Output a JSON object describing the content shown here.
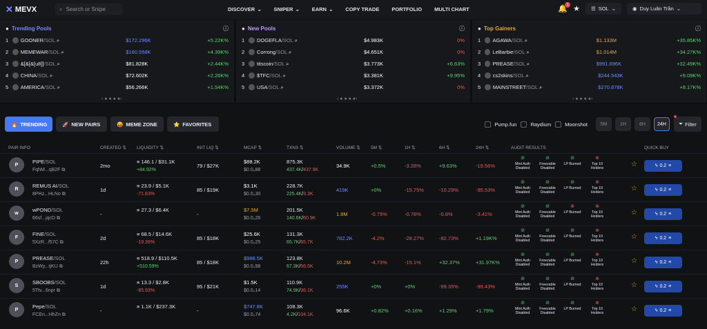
{
  "nav": {
    "logo": "MEVX",
    "search_placeholder": "Search or Snipe",
    "menu": [
      {
        "label": "DISCOVER",
        "has_caret": true
      },
      {
        "label": "SNIPER",
        "has_caret": true
      },
      {
        "label": "EARN",
        "has_caret": true
      },
      {
        "label": "COPY TRADE",
        "has_caret": false
      },
      {
        "label": "PORTFOLIO",
        "has_caret": false
      },
      {
        "label": "MULTI CHART",
        "has_caret": false
      }
    ],
    "notification_count": "1",
    "chain": "SOL",
    "user": "Duy Luân Trần"
  },
  "panels": [
    {
      "title": "Trending Pools",
      "title_color": "#6f8cff",
      "rows": [
        {
          "n": "1",
          "name": "GOONER",
          "pair": "/SOL",
          "value": "$172.296K",
          "value_color": "#6f8cff",
          "change": "+5.22K%",
          "change_color": "#5bd172"
        },
        {
          "n": "2",
          "name": "MEMEWAR",
          "pair": "/SOL",
          "value": "$160.558K",
          "value_color": "#6f8cff",
          "change": "+4.39K%",
          "change_color": "#5bd172"
        },
        {
          "n": "3",
          "name": "&[&[&[u8]]",
          "pair": "/SOL",
          "value": "$81.828K",
          "value_color": "#ffffff",
          "change": "+2.44K%",
          "change_color": "#5bd172"
        },
        {
          "n": "4",
          "name": "CHINA",
          "pair": "/SOL",
          "value": "$72.602K",
          "value_color": "#ffffff",
          "change": "+2.26K%",
          "change_color": "#5bd172"
        },
        {
          "n": "5",
          "name": "AMERICA",
          "pair": "/SOL",
          "value": "$56.266K",
          "value_color": "#ffffff",
          "change": "+1.54K%",
          "change_color": "#5bd172"
        }
      ]
    },
    {
      "title": "New Pools",
      "title_color": "#b999ff",
      "rows": [
        {
          "n": "1",
          "name": "DOGEFLA",
          "pair": "/SOL",
          "value": "$4.983K",
          "value_color": "#ffffff",
          "change": "0%",
          "change_color": "#e05b5b"
        },
        {
          "n": "2",
          "name": "Corrong",
          "pair": "/SOL",
          "value": "$4.651K",
          "value_color": "#ffffff",
          "change": "0%",
          "change_color": "#e05b5b"
        },
        {
          "n": "3",
          "name": "titscoin",
          "pair": "/SOL",
          "value": "$3.773K",
          "value_color": "#ffffff",
          "change": "+6.63%",
          "change_color": "#5bd172"
        },
        {
          "n": "4",
          "name": "$TFC",
          "pair": "/SOL",
          "value": "$3.381K",
          "value_color": "#ffffff",
          "change": "+9.95%",
          "change_color": "#5bd172"
        },
        {
          "n": "5",
          "name": "USA",
          "pair": "/SOL",
          "value": "$3.372K",
          "value_color": "#ffffff",
          "change": "0%",
          "change_color": "#e05b5b"
        }
      ]
    },
    {
      "title": "Top Gainers",
      "title_color": "#e2a93e",
      "rows": [
        {
          "n": "1",
          "name": "AGAWA",
          "pair": "/SOL",
          "value": "$1.133M",
          "value_color": "#e2a93e",
          "change": "+35.85K%",
          "change_color": "#5bd172"
        },
        {
          "n": "2",
          "name": "LeBarbie",
          "pair": "/SOL",
          "value": "$1.014M",
          "value_color": "#e2a93e",
          "change": "+34.27K%",
          "change_color": "#5bd172"
        },
        {
          "n": "3",
          "name": "PREASE",
          "pair": "/SOL",
          "value": "$991.696K",
          "value_color": "#6f8cff",
          "change": "+32.49K%",
          "change_color": "#5bd172"
        },
        {
          "n": "4",
          "name": "cs2skins",
          "pair": "/SOL",
          "value": "$244.543K",
          "value_color": "#6f8cff",
          "change": "+9.09K%",
          "change_color": "#5bd172"
        },
        {
          "n": "5",
          "name": "MAINSTREET",
          "pair": "/SOL",
          "value": "$270.878K",
          "value_color": "#6f8cff",
          "change": "+8.17K%",
          "change_color": "#5bd172"
        }
      ]
    }
  ],
  "tabs": [
    {
      "label": "TRENDING",
      "icon": "🔥",
      "active": true
    },
    {
      "label": "NEW PAIRS",
      "icon": "🚀",
      "active": false
    },
    {
      "label": "MEME ZONE",
      "icon": "😝",
      "active": false
    },
    {
      "label": "FAVORITES",
      "icon": "⭐",
      "active": false
    }
  ],
  "filters": {
    "sources": [
      "Pump.fun",
      "Raydium",
      "Moonshot"
    ],
    "timeframes": [
      "5M",
      "1H",
      "6H",
      "24H"
    ],
    "active_timeframe": "24H",
    "filter_label": "Filter"
  },
  "headers": [
    "PAIR INFO",
    "CREATED",
    "LIQUIDITY",
    "INIT LIQ",
    "MCAP",
    "TXNS",
    "VOLUME",
    "5M",
    "1H",
    "6H",
    "24H",
    "AUDIT RESULTS",
    "QUICK BUY"
  ],
  "audit_labels": [
    "Mint Auth Disabled",
    "Freezable Disabled",
    "LP Burned",
    "Top 10 Holders"
  ],
  "rows": [
    {
      "name": "PIPE",
      "pair": "/SOL",
      "addr": "FqhM...qB2F",
      "created": "2mo",
      "liq": "146.1 / $31.1K",
      "liq_chg": "+84.92%",
      "liq_chg_color": "#5bd172",
      "init": "79 / $27K",
      "mcap": "$88.2K",
      "mcap_color": "#ffffff",
      "mcap_sub": "$0.0₀88",
      "txns": "875.3K",
      "buys": "437.4K",
      "sells": "437.9K",
      "vol": "34.9K",
      "vol_color": "#ffffff",
      "m5": "+0.5%",
      "m5_color": "#5bd172",
      "h1": "-3.28%",
      "h1_color": "#e05b5b",
      "h6": "+9.63%",
      "h6_color": "#5bd172",
      "h24": "-19.56%",
      "h24_color": "#e05b5b",
      "audit": [
        "ok",
        "ok",
        "ok",
        "bad"
      ],
      "buy": "0.2"
    },
    {
      "name": "REMUS AI",
      "pair": "/SOL",
      "addr": "8PHz...HLNo",
      "created": "1d",
      "liq": "23.9 / $5.1K",
      "liq_chg": "-71.83%",
      "liq_chg_color": "#e05b5b",
      "init": "85 / $19K",
      "mcap": "$3.1K",
      "mcap_color": "#ffffff",
      "mcap_sub": "$0.0₀30",
      "txns": "228.7K",
      "buys": "225.4K",
      "sells": "3.3K",
      "vol": "419K",
      "vol_color": "#6f8cff",
      "m5": "+0%",
      "m5_color": "#5bd172",
      "h1": "-15.75%",
      "h1_color": "#e05b5b",
      "h6": "-10.29%",
      "h6_color": "#e05b5b",
      "h24": "-95.53%",
      "h24_color": "#e05b5b",
      "audit": [
        "ok",
        "ok",
        "ok",
        "bad"
      ],
      "buy": "0.2"
    },
    {
      "name": "wPOND",
      "pair": "/SOL",
      "addr": "66sf...jqcD",
      "created": "-",
      "liq": "27.3 / $6.4K",
      "liq_chg": "",
      "liq_chg_color": "#5bd172",
      "init": "-",
      "mcap": "$7.5M",
      "mcap_color": "#e2a93e",
      "mcap_sub": "$0.0₀26",
      "txns": "201.5K",
      "buys": "140.6K",
      "sells": "60.9K",
      "vol": "1.8M",
      "vol_color": "#e2a93e",
      "m5": "-0.79%",
      "m5_color": "#e05b5b",
      "h1": "-0.78%",
      "h1_color": "#e05b5b",
      "h6": "-0.8%",
      "h6_color": "#e05b5b",
      "h24": "-3.41%",
      "h24_color": "#e05b5b",
      "audit": [
        "ok",
        "ok",
        "bad",
        "bad"
      ],
      "buy": "0.2"
    },
    {
      "name": "FINE",
      "pair": "/SOL",
      "addr": "5XzR...f57C",
      "created": "2d",
      "liq": "68.5 / $14.6K",
      "liq_chg": "-19.36%",
      "liq_chg_color": "#e05b5b",
      "init": "85 / $18K",
      "mcap": "$25.6K",
      "mcap_color": "#ffffff",
      "mcap_sub": "$0.0₀25",
      "txns": "131.3K",
      "buys": "65.7K",
      "sells": "65.7K",
      "vol": "782.2K",
      "vol_color": "#6f8cff",
      "m5": "-4.2%",
      "m5_color": "#e05b5b",
      "h1": "-28.27%",
      "h1_color": "#e05b5b",
      "h6": "-82.73%",
      "h6_color": "#e05b5b",
      "h24": "+1.19K%",
      "h24_color": "#5bd172",
      "audit": [
        "ok",
        "ok",
        "ok",
        "bad"
      ],
      "buy": "0.2"
    },
    {
      "name": "PREASE",
      "pair": "/SOL",
      "addr": "BzWy...tjKU",
      "created": "22h",
      "liq": "518.9 / $110.5K",
      "liq_chg": "+510.59%",
      "liq_chg_color": "#5bd172",
      "init": "85 / $18K",
      "mcap": "$988.5K",
      "mcap_color": "#6f8cff",
      "mcap_sub": "$0.0₀98",
      "txns": "123.8K",
      "buys": "67.3K",
      "sells": "56.5K",
      "vol": "10.2M",
      "vol_color": "#e2a93e",
      "m5": "-4.73%",
      "m5_color": "#e05b5b",
      "h1": "-15.1%",
      "h1_color": "#e05b5b",
      "h6": "+32.37%",
      "h6_color": "#5bd172",
      "h24": "+31.97K%",
      "h24_color": "#5bd172",
      "audit": [
        "ok",
        "ok",
        "ok",
        "bad"
      ],
      "buy": "0.2"
    },
    {
      "name": "SBOOBS",
      "pair": "/SOL",
      "addr": "5Ttv...6npr",
      "created": "1d",
      "liq": "13.3 / $2.8K",
      "liq_chg": "-85.93%",
      "liq_chg_color": "#e05b5b",
      "init": "95 / $21K",
      "mcap": "$1.5K",
      "mcap_color": "#ffffff",
      "mcap_sub": "$0.0₀14",
      "txns": "110.9K",
      "buys": "74.9K",
      "sells": "36.1K",
      "vol": "255K",
      "vol_color": "#6f8cff",
      "m5": "+0%",
      "m5_color": "#5bd172",
      "h1": "+0%",
      "h1_color": "#5bd172",
      "h6": "-99.35%",
      "h6_color": "#e05b5b",
      "h24": "-99.43%",
      "h24_color": "#e05b5b",
      "audit": [
        "ok",
        "ok",
        "ok",
        "bad"
      ],
      "buy": "0.2"
    },
    {
      "name": "Pepe",
      "pair": "/SOL",
      "addr": "FCEn...HhZn",
      "created": "-",
      "liq": "1.1K / $237.3K",
      "liq_chg": "",
      "liq_chg_color": "#5bd172",
      "init": "-",
      "mcap": "$747.8K",
      "mcap_color": "#6f8cff",
      "mcap_sub": "$0.0₀74",
      "txns": "108.3K",
      "buys": "4.2K",
      "sells": "104.1K",
      "vol": "96.6K",
      "vol_color": "#ffffff",
      "m5": "+0.82%",
      "m5_color": "#5bd172",
      "h1": "+0.16%",
      "h1_color": "#5bd172",
      "h6": "+1.29%",
      "h6_color": "#5bd172",
      "h24": "+1.79%",
      "h24_color": "#5bd172",
      "audit": [
        "ok",
        "ok",
        "ok",
        "bad"
      ],
      "buy": "0.2"
    }
  ]
}
